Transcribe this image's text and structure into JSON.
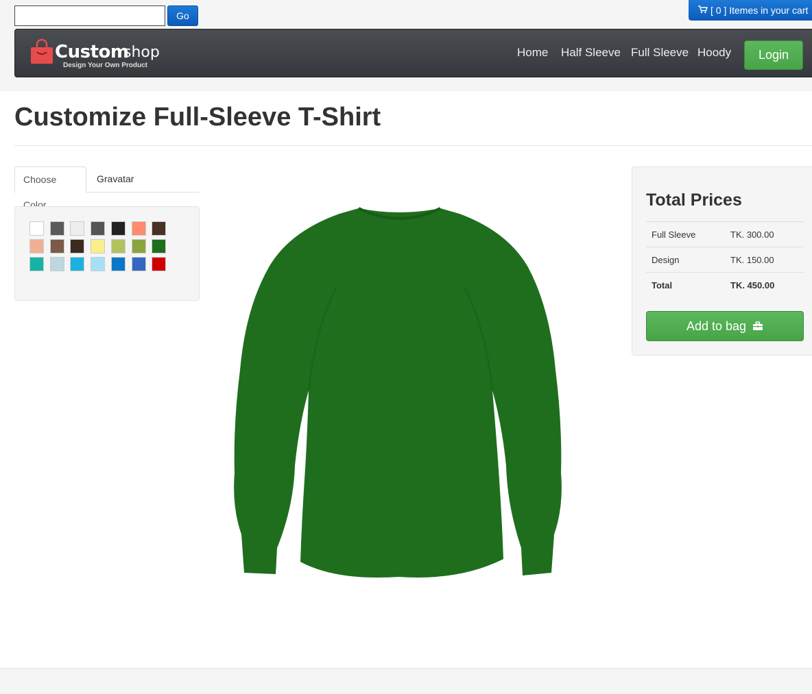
{
  "search": {
    "value": "",
    "placeholder": "",
    "go_label": "Go"
  },
  "cart": {
    "label": "[ 0 ] Itemes in your cart",
    "icon": "shopping-cart-icon"
  },
  "brand": {
    "name_bold": "Custom",
    "name_light": "shop",
    "tagline": "Design Your Own Product",
    "icon": "shopping-bag-icon",
    "icon_color": "#e74c4c"
  },
  "nav": {
    "links": [
      {
        "label": "Home"
      },
      {
        "label": "Half Sleeve"
      },
      {
        "label": "Full Sleeve"
      },
      {
        "label": "Hoody"
      }
    ],
    "login_label": "Login"
  },
  "page": {
    "title": "Customize Full-Sleeve T-Shirt"
  },
  "tabs": [
    {
      "label": "Choose Color",
      "active": true
    },
    {
      "label": "Gravatar",
      "active": false
    }
  ],
  "colors": [
    "#ffffff",
    "#5a5a5a",
    "#eeeeee",
    "#555555",
    "#222222",
    "#ff8a6e",
    "#4a2f26",
    "#f0b095",
    "#7b5a4a",
    "#3a2a20",
    "#fbee8c",
    "#b3c15e",
    "#8ca43e",
    "#1e6e1e",
    "#16b3a5",
    "#bcd8de",
    "#1cb1e0",
    "#a7e0f6",
    "#0a78c8",
    "#3367c2",
    "#d10000"
  ],
  "product": {
    "name": "Full Sleeve T-Shirt",
    "selected_color": "#1e6e1e"
  },
  "prices": {
    "title": "Total Prices",
    "rows": [
      {
        "label": "Full Sleeve",
        "amount": "TK. 300.00"
      },
      {
        "label": "Design",
        "amount": "TK. 150.00"
      },
      {
        "label": "Total",
        "amount": "TK. 450.00"
      }
    ],
    "add_label": "Add to bag",
    "add_icon": "briefcase-icon"
  },
  "theme": {
    "accent_blue": "#0b5bb8",
    "accent_green": "#5cb85c",
    "navbar": "#3e4145"
  }
}
